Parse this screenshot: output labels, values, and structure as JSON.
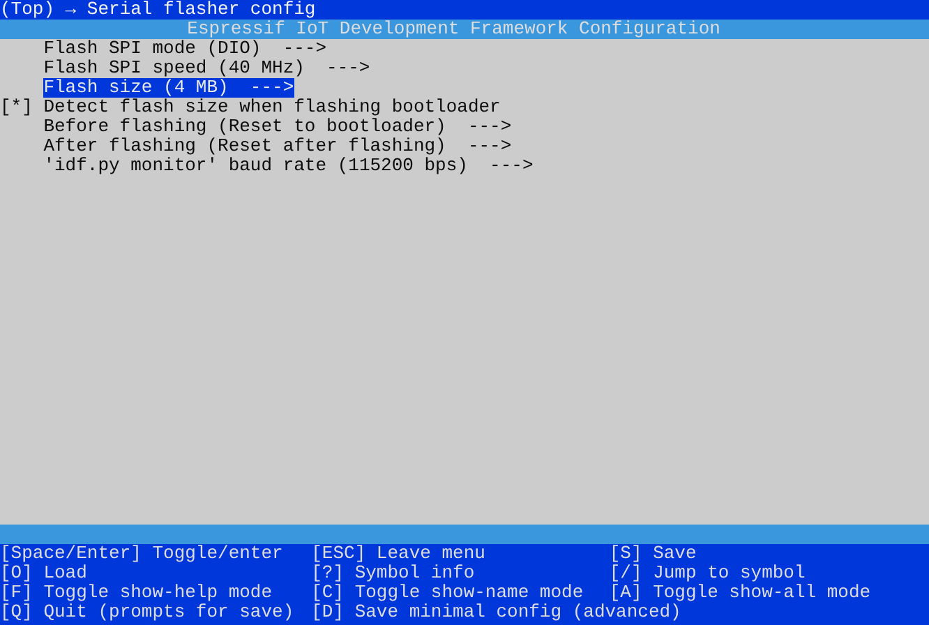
{
  "breadcrumb": "(Top) → Serial flasher config",
  "header": "Espressif IoT Development Framework Configuration",
  "items": [
    {
      "kind": "menu",
      "label": "Flash SPI mode (DIO)",
      "arrow": "--->",
      "selected": false
    },
    {
      "kind": "menu",
      "label": "Flash SPI speed (40 MHz)",
      "arrow": "--->",
      "selected": false
    },
    {
      "kind": "menu",
      "label": "Flash size (4 MB)",
      "arrow": "--->",
      "selected": true
    },
    {
      "kind": "bool",
      "label": "Detect flash size when flashing bootloader",
      "box": "[*]",
      "checked": true,
      "selected": false
    },
    {
      "kind": "menu",
      "label": "Before flashing (Reset to bootloader)",
      "arrow": "--->",
      "selected": false
    },
    {
      "kind": "menu",
      "label": "After flashing (Reset after flashing)",
      "arrow": "--->",
      "selected": false
    },
    {
      "kind": "menu",
      "label": "'idf.py monitor' baud rate (115200 bps)",
      "arrow": "--->",
      "selected": false
    }
  ],
  "help": [
    "[Space/Enter] Toggle/enter",
    "[ESC] Leave menu",
    "[S] Save",
    "[O] Load",
    "[?] Symbol info",
    "[/] Jump to symbol",
    "[F] Toggle show-help mode",
    "[C] Toggle show-name mode",
    "[A] Toggle show-all mode",
    "[Q] Quit (prompts for save)",
    "[D] Save minimal config (advanced)"
  ]
}
